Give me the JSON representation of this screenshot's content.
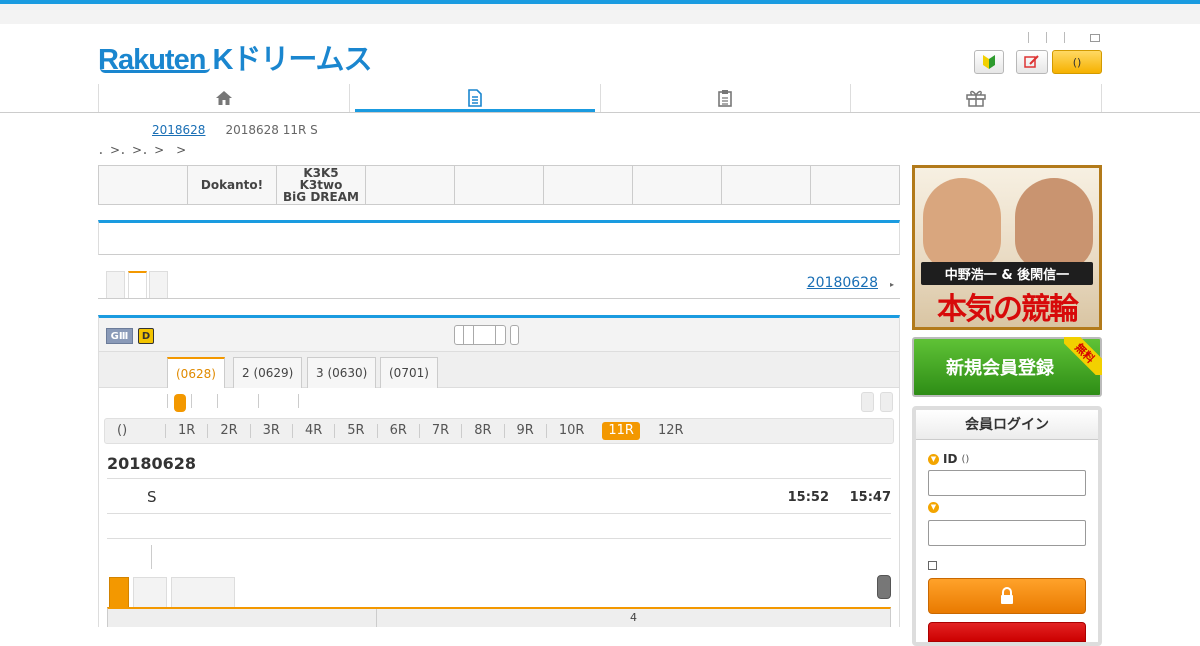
{
  "header": {
    "logo_text": "Rakuten Kドリームス"
  },
  "breadcrumb": {
    "link": "2018628",
    "current": "2018628 11R S"
  },
  "subcrumb": "．>．>．>　>",
  "venues": [
    "",
    "Dokanto!",
    "K3K5\nK3two\nBiG DREAM",
    "",
    "",
    "",
    "",
    "",
    ""
  ],
  "date_link": "20180628",
  "date_link_arrow": "▸",
  "grade_badges": {
    "g3": "GⅢ",
    "d": "D"
  },
  "day_tabs": [
    "(0628)",
    "2 (0629)",
    "3 (0630)",
    "(0701)"
  ],
  "race_bar": {
    "first": "()",
    "races": [
      "1R",
      "2R",
      "3R",
      "4R",
      "5R",
      "6R",
      "7R",
      "8R",
      "9R",
      "10R",
      "11R",
      "12R"
    ],
    "active": "11R"
  },
  "race": {
    "date": "20180628",
    "name": "S",
    "time1": "15:52",
    "time2": "15:47"
  },
  "table": {
    "col_num": "4"
  },
  "ad": {
    "title1": "中野浩一 & 後閑信一",
    "title2": "本気の競輪 TV"
  },
  "register": {
    "label": "新規会員登録",
    "ribbon": "無料"
  },
  "login": {
    "title": "会員ログイン",
    "id_label": "ID",
    "id_hint": "()",
    "pw_label": ""
  },
  "colors": {
    "accent_blue": "#1a9be0",
    "accent_orange": "#f39800"
  }
}
